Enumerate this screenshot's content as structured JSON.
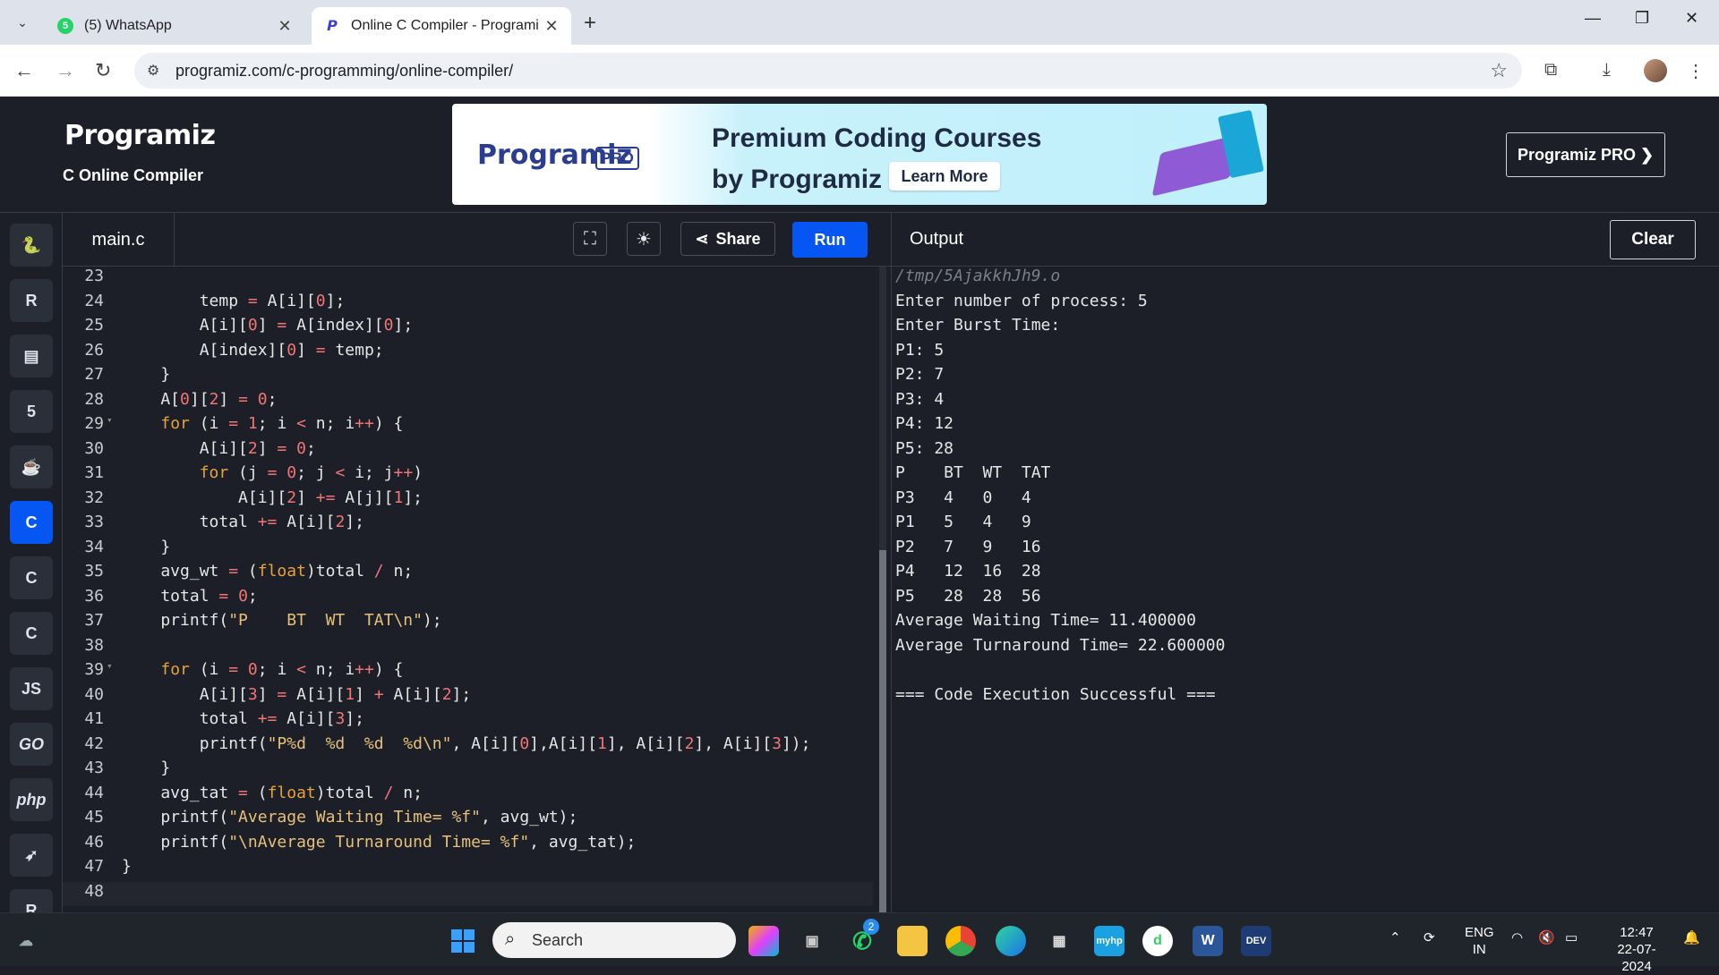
{
  "browser": {
    "tabs": [
      {
        "title": "(5) WhatsApp",
        "favicon_badge": "5"
      },
      {
        "title": "Online C Compiler - Programiz"
      }
    ],
    "url": "programiz.com/c-programming/online-compiler/"
  },
  "header": {
    "logo": "Programiz",
    "subtitle": "C Online Compiler",
    "banner": {
      "brand": "Programiz",
      "brand_tag": "PRO",
      "line1": "Premium Coding Courses",
      "line2": "by Programiz",
      "cta": "Learn More"
    },
    "pro_button": "Programiz PRO ❯"
  },
  "sidebar": {
    "items": [
      {
        "name": "python",
        "glyph": "🐍"
      },
      {
        "name": "r",
        "glyph": "R"
      },
      {
        "name": "sql",
        "glyph": "▤"
      },
      {
        "name": "html",
        "glyph": "5"
      },
      {
        "name": "java",
        "glyph": "☕"
      },
      {
        "name": "c",
        "glyph": "C"
      },
      {
        "name": "cpp",
        "glyph": "C"
      },
      {
        "name": "csharp",
        "glyph": "C"
      },
      {
        "name": "js",
        "glyph": "JS"
      },
      {
        "name": "go",
        "glyph": "GO"
      },
      {
        "name": "php",
        "glyph": "php"
      },
      {
        "name": "swift",
        "glyph": "➶"
      },
      {
        "name": "rust",
        "glyph": "R"
      }
    ]
  },
  "editor": {
    "filename": "main.c",
    "share_label": "Share",
    "run_label": "Run",
    "lines": [
      {
        "n": "23",
        "code": ""
      },
      {
        "n": "24",
        "code": "        temp = A[i][0];"
      },
      {
        "n": "25",
        "code": "        A[i][0] = A[index][0];"
      },
      {
        "n": "26",
        "code": "        A[index][0] = temp;"
      },
      {
        "n": "27",
        "code": "    }"
      },
      {
        "n": "28",
        "code": "    A[0][2] = 0;"
      },
      {
        "n": "29",
        "code": "    for (i = 1; i < n; i++) {",
        "fold": true
      },
      {
        "n": "30",
        "code": "        A[i][2] = 0;"
      },
      {
        "n": "31",
        "code": "        for (j = 0; j < i; j++)"
      },
      {
        "n": "32",
        "code": "            A[i][2] += A[j][1];"
      },
      {
        "n": "33",
        "code": "        total += A[i][2];"
      },
      {
        "n": "34",
        "code": "    }"
      },
      {
        "n": "35",
        "code": "    avg_wt = (float)total / n;"
      },
      {
        "n": "36",
        "code": "    total = 0;"
      },
      {
        "n": "37",
        "code": "    printf(\"P    BT  WT  TAT\\n\");"
      },
      {
        "n": "38",
        "code": ""
      },
      {
        "n": "39",
        "code": "    for (i = 0; i < n; i++) {",
        "fold": true
      },
      {
        "n": "40",
        "code": "        A[i][3] = A[i][1] + A[i][2];"
      },
      {
        "n": "41",
        "code": "        total += A[i][3];"
      },
      {
        "n": "42",
        "code": "        printf(\"P%d  %d  %d  %d\\n\", A[i][0],A[i][1], A[i][2], A[i][3]);"
      },
      {
        "n": "43",
        "code": "    }"
      },
      {
        "n": "44",
        "code": "    avg_tat = (float)total / n;"
      },
      {
        "n": "45",
        "code": "    printf(\"Average Waiting Time= %f\", avg_wt);"
      },
      {
        "n": "46",
        "code": "    printf(\"\\nAverage Turnaround Time= %f\", avg_tat);"
      },
      {
        "n": "47",
        "code": "}"
      },
      {
        "n": "48",
        "code": ""
      }
    ]
  },
  "output": {
    "title": "Output",
    "clear_label": "Clear",
    "lines": [
      "/tmp/5AjakkhJh9.o",
      "Enter number of process: 5",
      "Enter Burst Time:",
      "P1: 5",
      "P2: 7",
      "P3: 4",
      "P4: 12",
      "P5: 28",
      "P    BT  WT  TAT",
      "P3   4   0   4",
      "P1   5   4   9",
      "P2   7   9   16",
      "P4   12  16  28",
      "P5   28  28  56",
      "Average Waiting Time= 11.400000",
      "Average Turnaround Time= 22.600000",
      "",
      "=== Code Execution Successful ==="
    ]
  },
  "taskbar": {
    "search_placeholder": "Search",
    "whatsapp_badge": "2",
    "lang_top": "ENG",
    "lang_bottom": "IN",
    "time": "12:47",
    "date": "22-07-2024"
  },
  "colors": {
    "accent": "#0556f3",
    "background": "#1c1f27",
    "keyword": "#e8a23a",
    "number": "#f07575",
    "string": "#e6c07b"
  }
}
